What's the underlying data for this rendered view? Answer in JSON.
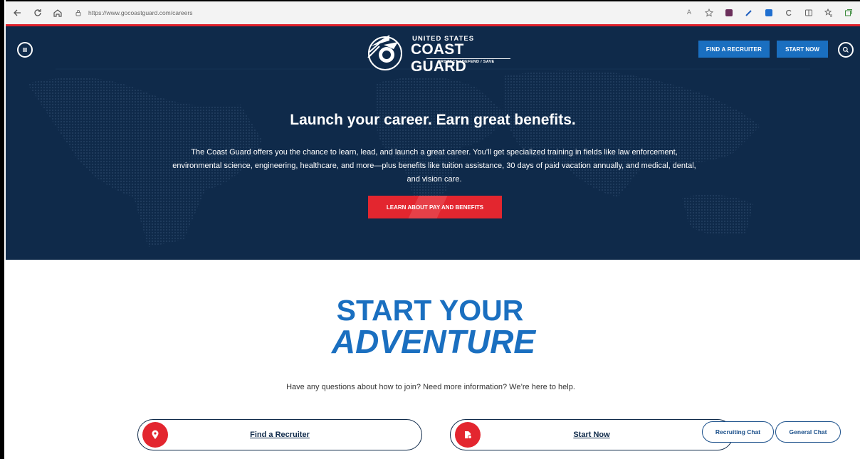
{
  "browser": {
    "url": "https://www.gocoastguard.com/careers",
    "nav_icons": [
      "back-icon",
      "refresh-icon",
      "home-icon"
    ],
    "toolbar_icons": [
      "read-aloud-icon",
      "favorite-icon",
      "extension-icon",
      "pen-icon",
      "outlook-icon",
      "copilot-icon",
      "split-screen-icon",
      "favorites-icon",
      "collections-icon"
    ]
  },
  "header": {
    "logo_line1": "UNITED STATES",
    "logo_line2": "COAST GUARD",
    "logo_tagline": "PROTECT / DEFEND / SAVE",
    "find_recruiter": "FIND A RECRUITER",
    "start_now": "START NOW"
  },
  "hero": {
    "title": "Launch your career. Earn great benefits.",
    "body": "The Coast Guard offers you the chance to learn, lead, and launch a great career. You’ll get specialized training in fields like law enforcement, environmental science, engineering, healthcare, and more—plus benefits like tuition assistance, 30 days of paid vacation annually, and medical, dental, and vision care.",
    "cta": "LEARN ABOUT PAY AND BENEFITS"
  },
  "adventure": {
    "title_line1": "START YOUR",
    "title_line2": "ADVENTURE",
    "subtitle": "Have any questions about how to join? Need more information? We’re here to help.",
    "find_recruiter": "Find a Recruiter",
    "start_now": "Start Now"
  },
  "chat": {
    "recruiting": "Recruiting Chat",
    "general": "General Chat"
  },
  "colors": {
    "navy": "#0f2a4a",
    "blue": "#1a6fc0",
    "red": "#e3262f"
  }
}
